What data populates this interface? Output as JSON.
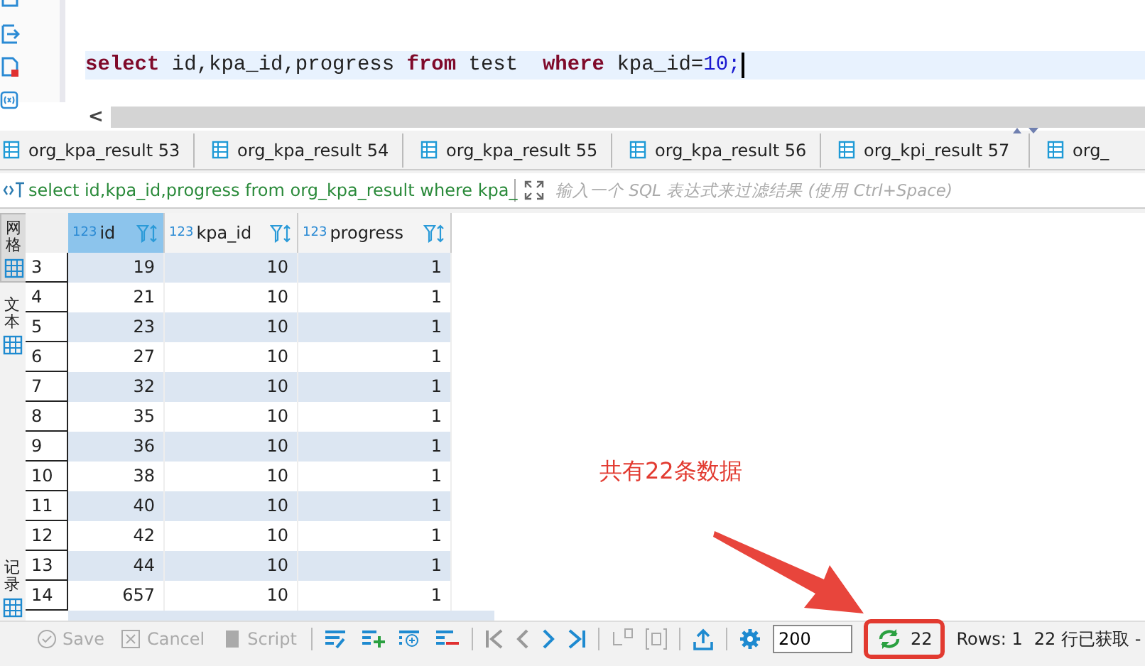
{
  "editor": {
    "code_tokens": [
      {
        "text": "select",
        "kind": "keyword"
      },
      {
        "text": " id,kpa_id,progress ",
        "kind": "plain"
      },
      {
        "text": "from",
        "kind": "keyword"
      },
      {
        "text": " test  ",
        "kind": "plain"
      },
      {
        "text": "where",
        "kind": "keyword"
      },
      {
        "text": " kpa_id=",
        "kind": "plain"
      },
      {
        "text": "10;",
        "kind": "number"
      }
    ],
    "scroll_left": "<"
  },
  "tabs": [
    {
      "label": "org_kpa_result 53",
      "selected": false
    },
    {
      "label": "org_kpa_result 54",
      "selected": false
    },
    {
      "label": "org_kpa_result 55",
      "selected": false
    },
    {
      "label": "org_kpa_result 56",
      "selected": false
    },
    {
      "label": "org_kpi_result 57",
      "selected": false
    },
    {
      "label": "org_",
      "selected": false
    }
  ],
  "filter": {
    "query": "select id,kpa_id,progress from org_kpa_result where kpa_",
    "placeholder": "输入一个 SQL 表达式来过滤结果 (使用 Ctrl+Space)"
  },
  "side_tabs": [
    {
      "label": "网格",
      "selected": true
    },
    {
      "label": "文本",
      "selected": false
    },
    {
      "label": "记录",
      "selected": false
    }
  ],
  "table": {
    "columns": [
      {
        "type_badge": "123",
        "label": "id",
        "selected": true
      },
      {
        "type_badge": "123",
        "label": "kpa_id",
        "selected": false
      },
      {
        "type_badge": "123",
        "label": "progress",
        "selected": false
      }
    ],
    "rows": [
      {
        "row_number": "3",
        "cells": [
          "19",
          "10",
          "1"
        ]
      },
      {
        "row_number": "4",
        "cells": [
          "21",
          "10",
          "1"
        ]
      },
      {
        "row_number": "5",
        "cells": [
          "23",
          "10",
          "1"
        ]
      },
      {
        "row_number": "6",
        "cells": [
          "27",
          "10",
          "1"
        ]
      },
      {
        "row_number": "7",
        "cells": [
          "32",
          "10",
          "1"
        ]
      },
      {
        "row_number": "8",
        "cells": [
          "35",
          "10",
          "1"
        ]
      },
      {
        "row_number": "9",
        "cells": [
          "36",
          "10",
          "1"
        ]
      },
      {
        "row_number": "10",
        "cells": [
          "38",
          "10",
          "1"
        ]
      },
      {
        "row_number": "11",
        "cells": [
          "40",
          "10",
          "1"
        ]
      },
      {
        "row_number": "12",
        "cells": [
          "42",
          "10",
          "1"
        ]
      },
      {
        "row_number": "13",
        "cells": [
          "44",
          "10",
          "1"
        ]
      },
      {
        "row_number": "14",
        "cells": [
          "657",
          "10",
          "1"
        ]
      }
    ]
  },
  "toolbar": {
    "buttons": [
      {
        "label": "Save",
        "kind": "save",
        "disabled": true
      },
      {
        "label": "Cancel",
        "kind": "cancel",
        "disabled": true
      },
      {
        "label": "Script",
        "kind": "script",
        "disabled": true
      }
    ],
    "fetch_size": "200",
    "row_count": "22",
    "rows_status": "Rows: 1",
    "fetched": "22 行已获取 -"
  },
  "annotation": {
    "text": "共有22条数据"
  }
}
